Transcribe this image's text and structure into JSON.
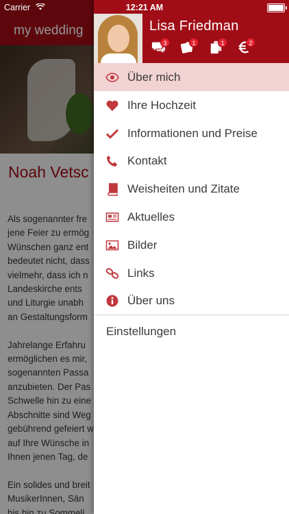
{
  "status_bar": {
    "carrier": "Carrier",
    "time": "12:21 AM"
  },
  "app": {
    "title": "my wedding",
    "heading": "Noah Vetsc",
    "body_text": "Als sogenannter fre\njene Feier zu ermög\nWünschen ganz ent\nbedeutet nicht, dass\nvielmehr, dass ich n\nLandeskirche ents\nund Liturgie unabh\nan Gestaltungsform\n\nJahrelange Erfahru\nermöglichen es mir,\nsogenannten Passa\nanzubieten. Der Pas\nSchwelle hin zu eine\nAbschnitte sind Weg\ngebührend gefeiert w\nauf Ihre Wünsche in\nIhnen jenen Tag, de\n\nEin solides und breit\nMusikerInnen, Sän\nbis hin zu Sommeli"
  },
  "drawer": {
    "user_name": "Lisa Friedman",
    "header_icons": [
      {
        "icon": "chat-bubbles-icon",
        "badge": "3"
      },
      {
        "icon": "cards-icon",
        "badge": "1"
      },
      {
        "icon": "documents-icon",
        "badge": "1"
      },
      {
        "icon": "euro-icon",
        "badge": "2"
      }
    ],
    "menu": [
      {
        "icon": "eye-icon",
        "label": "Über mich",
        "active": true
      },
      {
        "icon": "heart-icon",
        "label": "Ihre Hochzeit"
      },
      {
        "icon": "checkmark-icon",
        "label": "Informationen und Preise"
      },
      {
        "icon": "phone-icon",
        "label": "Kontakt"
      },
      {
        "icon": "book-icon",
        "label": "Weisheiten und Zitate"
      },
      {
        "icon": "newspaper-icon",
        "label": "Aktuelles"
      },
      {
        "icon": "picture-icon",
        "label": "Bilder"
      },
      {
        "icon": "link-icon",
        "label": "Links"
      },
      {
        "icon": "info-icon",
        "label": "Über uns"
      }
    ],
    "settings_label": "Einstellungen"
  },
  "colors": {
    "brand": "#a00d17",
    "accent_icon": "#c0373c",
    "active_row": "#f2d3d3",
    "badge": "#e5232f"
  }
}
